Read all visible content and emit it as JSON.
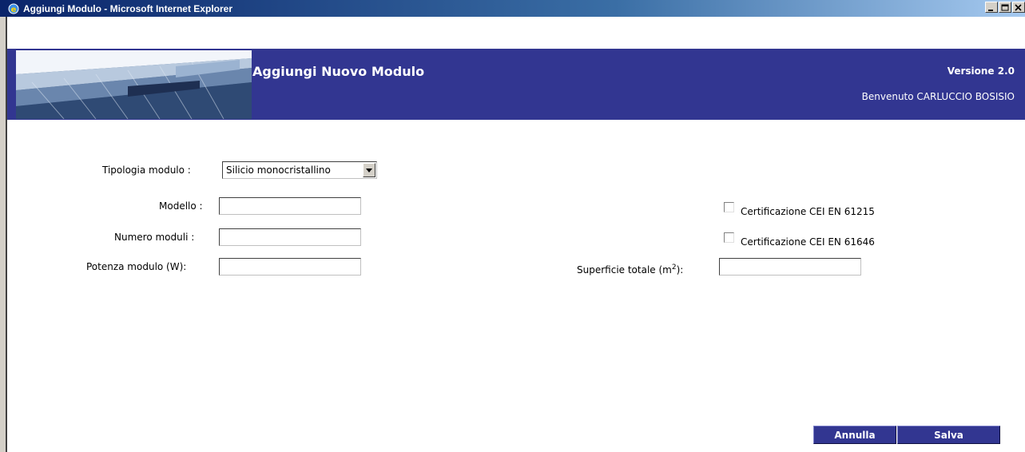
{
  "window": {
    "title": "Aggiungi Modulo - Microsoft Internet Explorer",
    "minimize_icon": "minimize-icon",
    "maximize_icon": "maximize-icon",
    "close_icon": "close-icon"
  },
  "header": {
    "title": "Aggiungi Nuovo Modulo",
    "version": "Versione 2.0",
    "welcome": "Benvenuto CARLUCCIO BOSISIO",
    "background_color": "#323691"
  },
  "form": {
    "tipologia": {
      "label": "Tipologia modulo :",
      "selected": "Silicio monocristallino"
    },
    "modello": {
      "label": "Modello :",
      "value": ""
    },
    "numero_moduli": {
      "label": "Numero moduli :",
      "value": ""
    },
    "potenza": {
      "label": "Potenza modulo (W):",
      "value": ""
    },
    "cert_61215": {
      "label": "Certificazione CEI EN 61215",
      "checked": false
    },
    "cert_61646": {
      "label": "Certificazione CEI EN 61646",
      "checked": false
    },
    "superficie": {
      "label_prefix": "Superficie totale (m",
      "label_sup": "2",
      "label_suffix": "):",
      "value": ""
    }
  },
  "actions": {
    "cancel_label": "Annulla",
    "save_label": "Salva"
  }
}
